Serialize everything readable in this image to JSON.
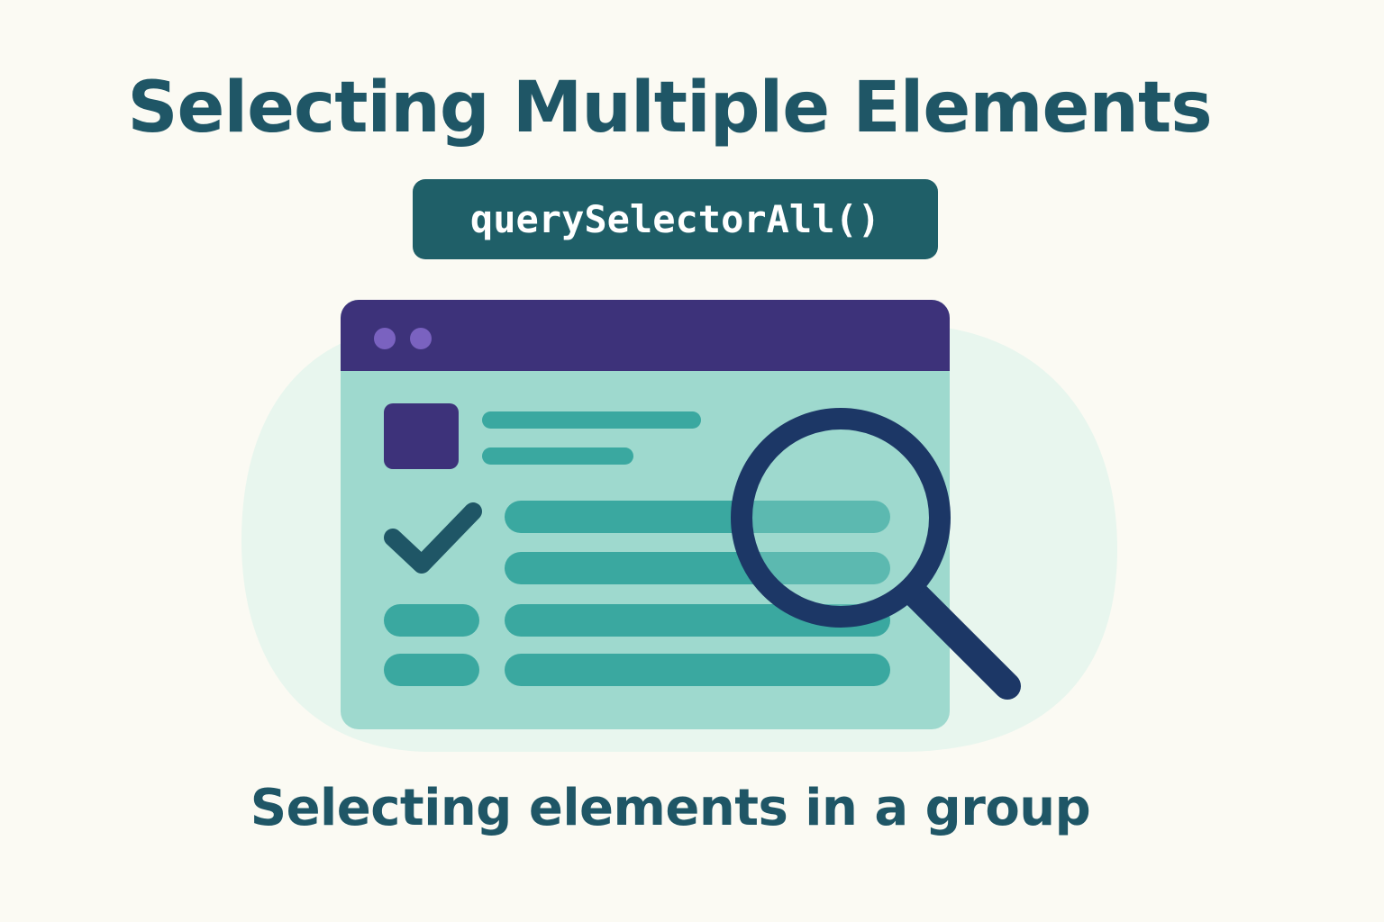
{
  "title": "Selecting Multiple Elements",
  "code_label": "querySelectorAll()",
  "subtitle": "Selecting elements in a group",
  "icons": [
    "browser-window-icon",
    "checkmark-icon",
    "magnifying-glass-icon"
  ],
  "colors": {
    "background": "#fbfaf3",
    "text": "#1f5666",
    "badge": "#1f5f68",
    "window_bar": "#3d327a",
    "window_body": "#9ed9ce",
    "line": "#3aa8a0",
    "magnifier": "#1c3766",
    "glow": "#e6f5ee"
  }
}
